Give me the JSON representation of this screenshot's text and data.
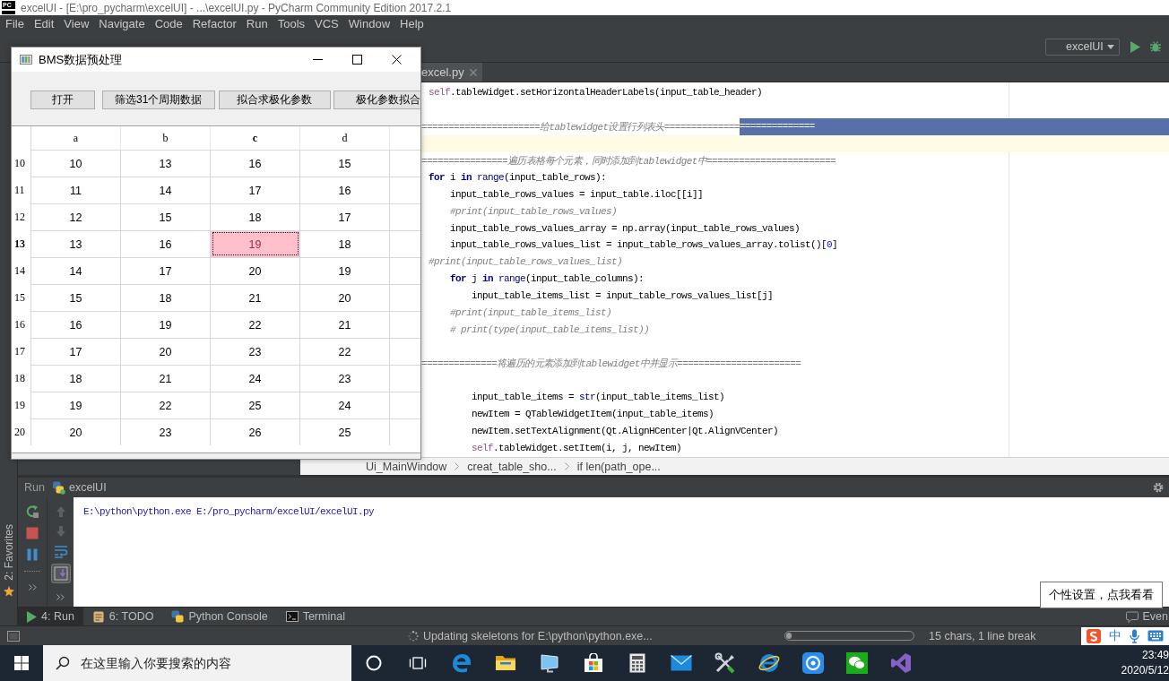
{
  "window": {
    "logo_text": "PC",
    "title": "excelUI - [E:\\pro_pycharm\\excelUI] - ...\\excelUI.py - PyCharm Community Edition 2017.2.1"
  },
  "menu": [
    "File",
    "Edit",
    "View",
    "Navigate",
    "Code",
    "Refactor",
    "Run",
    "Tools",
    "VCS",
    "Window",
    "Help"
  ],
  "toolbar": {
    "run_config": "excelUI"
  },
  "dialog": {
    "title": "BMS数据预处理",
    "buttons": [
      "打开",
      "筛选31个周期数据",
      "拟合求极化参数",
      "极化参数拟合"
    ],
    "table": {
      "columns": [
        {
          "label": "a",
          "selected": false
        },
        {
          "label": "b",
          "selected": false
        },
        {
          "label": "c",
          "selected": true
        },
        {
          "label": "d",
          "selected": false
        }
      ],
      "rows": [
        {
          "header": "10",
          "selected": false,
          "cells": [
            {
              "text": "10",
              "selected": false
            },
            {
              "text": "13",
              "selected": false
            },
            {
              "text": "16",
              "selected": false
            },
            {
              "text": "15",
              "selected": false
            }
          ]
        },
        {
          "header": "11",
          "selected": false,
          "cells": [
            {
              "text": "11",
              "selected": false
            },
            {
              "text": "14",
              "selected": false
            },
            {
              "text": "17",
              "selected": false
            },
            {
              "text": "16",
              "selected": false
            }
          ]
        },
        {
          "header": "12",
          "selected": false,
          "cells": [
            {
              "text": "12",
              "selected": false
            },
            {
              "text": "15",
              "selected": false
            },
            {
              "text": "18",
              "selected": false
            },
            {
              "text": "17",
              "selected": false
            }
          ]
        },
        {
          "header": "13",
          "selected": true,
          "cells": [
            {
              "text": "13",
              "selected": false
            },
            {
              "text": "16",
              "selected": false
            },
            {
              "text": "19",
              "selected": true
            },
            {
              "text": "18",
              "selected": false
            }
          ]
        },
        {
          "header": "14",
          "selected": false,
          "cells": [
            {
              "text": "14",
              "selected": false
            },
            {
              "text": "17",
              "selected": false
            },
            {
              "text": "20",
              "selected": false
            },
            {
              "text": "19",
              "selected": false
            }
          ]
        },
        {
          "header": "15",
          "selected": false,
          "cells": [
            {
              "text": "15",
              "selected": false
            },
            {
              "text": "18",
              "selected": false
            },
            {
              "text": "21",
              "selected": false
            },
            {
              "text": "20",
              "selected": false
            }
          ]
        },
        {
          "header": "16",
          "selected": false,
          "cells": [
            {
              "text": "16",
              "selected": false
            },
            {
              "text": "19",
              "selected": false
            },
            {
              "text": "22",
              "selected": false
            },
            {
              "text": "21",
              "selected": false
            }
          ]
        },
        {
          "header": "17",
          "selected": false,
          "cells": [
            {
              "text": "17",
              "selected": false
            },
            {
              "text": "20",
              "selected": false
            },
            {
              "text": "23",
              "selected": false
            },
            {
              "text": "22",
              "selected": false
            }
          ]
        },
        {
          "header": "18",
          "selected": false,
          "cells": [
            {
              "text": "18",
              "selected": false
            },
            {
              "text": "21",
              "selected": false
            },
            {
              "text": "24",
              "selected": false
            },
            {
              "text": "23",
              "selected": false
            }
          ]
        },
        {
          "header": "19",
          "selected": false,
          "cells": [
            {
              "text": "19",
              "selected": false
            },
            {
              "text": "22",
              "selected": false
            },
            {
              "text": "25",
              "selected": false
            },
            {
              "text": "24",
              "selected": false
            }
          ]
        },
        {
          "header": "20",
          "selected": false,
          "cells": [
            {
              "text": "20",
              "selected": false
            },
            {
              "text": "23",
              "selected": false
            },
            {
              "text": "26",
              "selected": false
            },
            {
              "text": "25",
              "selected": false
            }
          ]
        }
      ]
    }
  },
  "editor": {
    "tab": "excel.py",
    "lines": [
      {
        "kind": "code",
        "current": false,
        "tokens": [
          {
            "text": "self",
            "kind": "self"
          },
          {
            "text": ".tableWidget.setHorizontalHeaderLabels(input_table_header)",
            "kind": "plain"
          }
        ]
      },
      {
        "kind": "blank",
        "current": false
      },
      {
        "kind": "separator",
        "current": false,
        "text": "======================给tablewidget设置行列表头==============",
        "selected_text": "=============="
      },
      {
        "kind": "blank",
        "current": true
      },
      {
        "kind": "separator",
        "current": false,
        "text": "================遍历表格每个元素，同时添加到tablewidget中========================"
      },
      {
        "kind": "code",
        "current": false,
        "tokens": [
          {
            "text": "for",
            "kind": "keyword"
          },
          {
            "text": " i ",
            "kind": "plain"
          },
          {
            "text": "in ",
            "kind": "keyword"
          },
          {
            "text": "range",
            "kind": "builtin"
          },
          {
            "text": "(input_table_rows):",
            "kind": "plain"
          }
        ]
      },
      {
        "kind": "code",
        "current": false,
        "tokens": [
          {
            "text": "    input_table_rows_values = input_table.iloc[[i]]",
            "kind": "plain"
          }
        ]
      },
      {
        "kind": "code",
        "current": false,
        "tokens": [
          {
            "text": "    #print(input_table_rows_values)",
            "kind": "comment"
          }
        ]
      },
      {
        "kind": "code",
        "current": false,
        "tokens": [
          {
            "text": "    input_table_rows_values_array = np.array(input_table_rows_values)",
            "kind": "plain"
          }
        ]
      },
      {
        "kind": "code",
        "current": false,
        "tokens": [
          {
            "text": "    input_table_rows_values_list = input_table_rows_values_array.tolist()[",
            "kind": "plain"
          },
          {
            "text": "0",
            "kind": "number"
          },
          {
            "text": "]",
            "kind": "plain"
          }
        ]
      },
      {
        "kind": "code",
        "current": false,
        "tokens": [
          {
            "text": "#print(input_table_rows_values_list)",
            "kind": "comment"
          }
        ]
      },
      {
        "kind": "code",
        "current": false,
        "tokens": [
          {
            "text": "    for",
            "kind": "keyword"
          },
          {
            "text": " j ",
            "kind": "plain"
          },
          {
            "text": "in ",
            "kind": "keyword"
          },
          {
            "text": "range",
            "kind": "builtin"
          },
          {
            "text": "(input_table_columns):",
            "kind": "plain"
          }
        ]
      },
      {
        "kind": "code",
        "current": false,
        "tokens": [
          {
            "text": "        input_table_items_list = input_table_rows_values_list[j]",
            "kind": "plain"
          }
        ]
      },
      {
        "kind": "code",
        "current": false,
        "tokens": [
          {
            "text": "    #print(input_table_items_list)",
            "kind": "comment"
          }
        ]
      },
      {
        "kind": "code",
        "current": false,
        "tokens": [
          {
            "text": "    # print(type(input_table_items_list))",
            "kind": "comment"
          }
        ]
      },
      {
        "kind": "blank",
        "current": false
      },
      {
        "kind": "separator",
        "current": false,
        "text": "==============将遍历的元素添加到tablewidget中并显示======================="
      },
      {
        "kind": "blank",
        "current": false
      },
      {
        "kind": "code",
        "current": false,
        "tokens": [
          {
            "text": "        input_table_items = ",
            "kind": "plain"
          },
          {
            "text": "str",
            "kind": "builtin"
          },
          {
            "text": "(input_table_items_list)",
            "kind": "plain"
          }
        ]
      },
      {
        "kind": "code",
        "current": false,
        "tokens": [
          {
            "text": "        newItem = QTableWidgetItem(input_table_items)",
            "kind": "plain"
          }
        ]
      },
      {
        "kind": "code",
        "current": false,
        "tokens": [
          {
            "text": "        newItem.setTextAlignment(Qt.AlignHCenter|Qt.AlignVCenter)",
            "kind": "plain"
          }
        ]
      },
      {
        "kind": "code",
        "current": false,
        "tokens": [
          {
            "text": "        self",
            "kind": "self"
          },
          {
            "text": ".tableWidget.setItem(i, j, newItem)",
            "kind": "plain"
          }
        ]
      }
    ],
    "breadcrumbs": [
      "Ui_MainWindow",
      "creat_table_sho...",
      "if len(path_ope..."
    ]
  },
  "left_stripe": {
    "favorites": "2: Favorites"
  },
  "run_panel": {
    "label": "Run",
    "config": "excelUI",
    "console": "E:\\python\\python.exe E:/pro_pycharm/excelUI/excelUI.py"
  },
  "tool_tabs": [
    {
      "label": "4: Run",
      "kind": "run",
      "selected": true
    },
    {
      "label": "6: TODO",
      "kind": "todo",
      "selected": false
    },
    {
      "label": "Python Console",
      "kind": "console",
      "selected": false
    },
    {
      "label": "Terminal",
      "kind": "terminal",
      "selected": false
    }
  ],
  "event_log": "Even",
  "tooltip": "个性设置，点我看看",
  "status_bar": {
    "message": "Updating skeletons for E:\\python\\python.exe...",
    "progress": {
      "level": 0.04
    },
    "caret_info": "15 chars, 1 line break",
    "ime": "中"
  },
  "taskbar": {
    "search": {
      "placeholder": "在这里输入你要搜索的内容"
    },
    "time": "23:49",
    "date": "2020/5/12"
  }
}
